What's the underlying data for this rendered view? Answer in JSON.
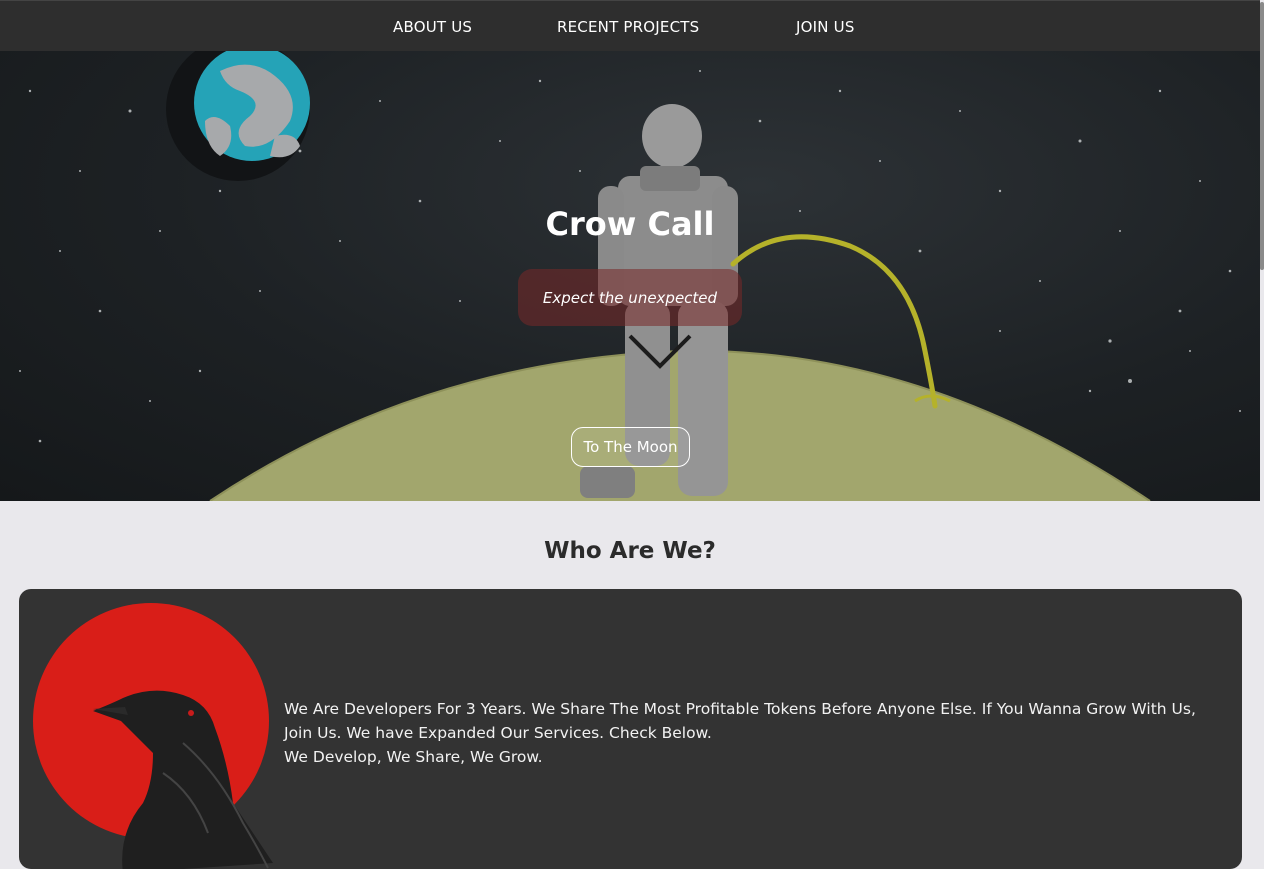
{
  "nav": {
    "items": [
      {
        "label": "ABOUT US"
      },
      {
        "label": "RECENT PROJECTS"
      },
      {
        "label": "JOIN US"
      }
    ]
  },
  "hero": {
    "title": "Crow Call",
    "tagline": "Expect the unexpected",
    "button_label": "To The Moon"
  },
  "about": {
    "title": "Who Are We?",
    "text_line1": "We Are Developers For 3 Years. We Share The Most Profitable Tokens Before Anyone Else. If You Wanna Grow With Us, Join Us. We have Expanded Our Services. Check Below.",
    "text_line2": "We Develop, We Share, We Grow."
  },
  "colors": {
    "nav_bg": "#2e2e2e",
    "page_bg": "#e9e8ec",
    "card_bg": "#333333",
    "tagline_bg": "#7a2a2a",
    "planet": "#a9ad73",
    "accent_yellow": "#b5b22a",
    "sun_red": "#d91e18"
  }
}
